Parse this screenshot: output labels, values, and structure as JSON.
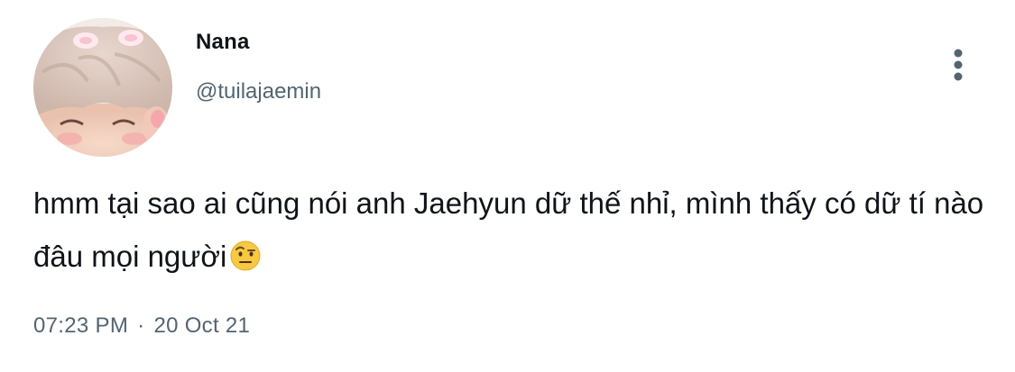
{
  "tweet": {
    "author": {
      "display_name": "Nana",
      "handle": "@tuilajaemin",
      "avatar_icon": "profile-photo"
    },
    "more_icon": "more-vertical-icon",
    "text": "hmm tại sao ai cũng nói anh Jaehyun dữ thế nhỉ, mình thấy có dữ tí nào đâu mọi người",
    "emoji": "face-with-raised-eyebrow",
    "time": "07:23 PM",
    "separator": "·",
    "date": "20 Oct 21"
  },
  "colors": {
    "text": "#0f1419",
    "secondary": "#536471",
    "icon": "#536471",
    "background": "#ffffff"
  }
}
